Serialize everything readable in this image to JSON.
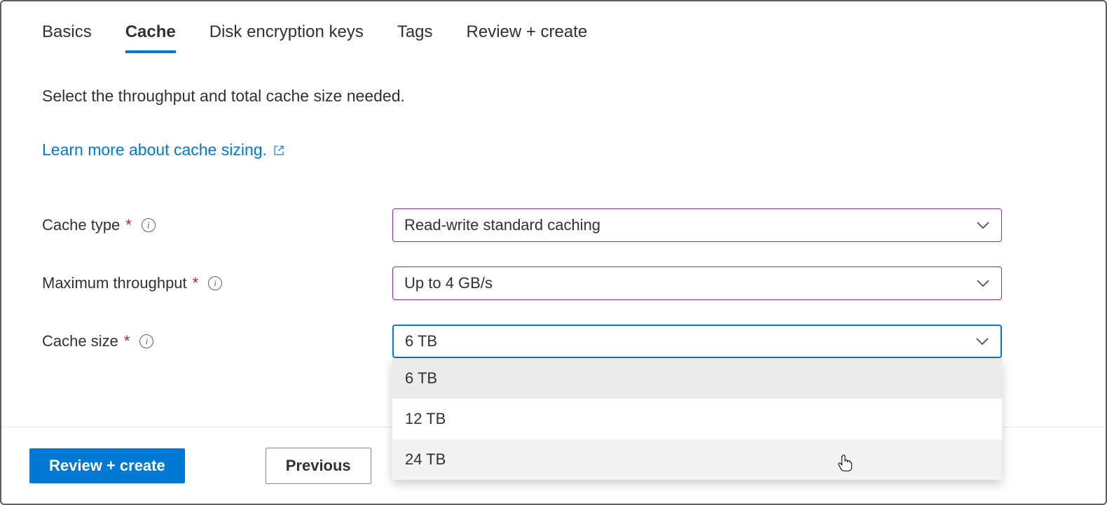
{
  "tabs": {
    "basics": "Basics",
    "cache": "Cache",
    "disk_encryption": "Disk encryption keys",
    "tags": "Tags",
    "review": "Review + create"
  },
  "description": "Select the throughput and total cache size needed.",
  "learn_more": "Learn more about cache sizing.",
  "form": {
    "cache_type": {
      "label": "Cache type",
      "value": "Read-write standard caching"
    },
    "max_throughput": {
      "label": "Maximum throughput",
      "value": "Up to 4 GB/s"
    },
    "cache_size": {
      "label": "Cache size",
      "value": "6 TB",
      "options": [
        "6 TB",
        "12 TB",
        "24 TB"
      ]
    }
  },
  "footer": {
    "review_btn": "Review + create",
    "previous_btn": "Previous"
  }
}
